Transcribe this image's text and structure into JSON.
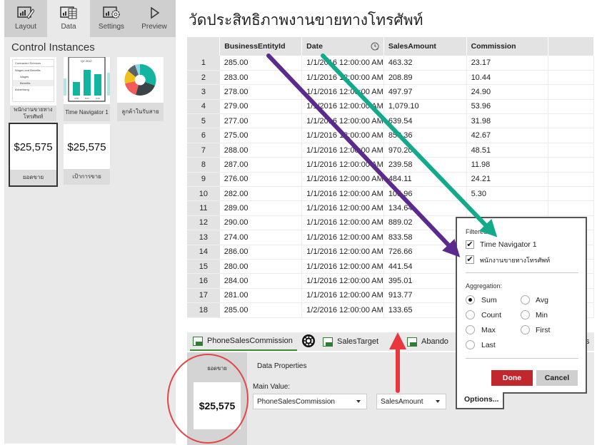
{
  "left_panel": {
    "tabs": [
      {
        "label": "Layout",
        "icon": "layout-chart-pencil-icon",
        "active": false
      },
      {
        "label": "Data",
        "icon": "data-chart-table-icon",
        "active": true
      },
      {
        "label": "Settings",
        "icon": "settings-chart-gear-icon",
        "active": false
      },
      {
        "label": "Preview",
        "icon": "play-triangle-icon",
        "active": false
      }
    ],
    "section_title": "Control Instances",
    "thumbnails": [
      {
        "caption": "พนักงานขายทางโทรศัพท์",
        "kind": "tree-list",
        "list_items": [
          "Contracted Services",
          "Wages and Benefits",
          "Wages",
          "Benefits",
          "Advertising"
        ]
      },
      {
        "caption": "Time Navigator 1",
        "kind": "time-navigator",
        "period": "Q2 2012",
        "months": [
          "APR",
          "MAY",
          "JUN"
        ]
      },
      {
        "caption": "ลูกค้าในรับสาย",
        "kind": "donut"
      },
      {
        "caption": "ยอดขาย",
        "kind": "kpi",
        "value": "$25,575",
        "selected": true
      },
      {
        "caption": "เป้าการขาย",
        "kind": "kpi",
        "value": "$25,575",
        "selected": false
      }
    ]
  },
  "main": {
    "title": "วัดประสิทธิภาพงานขายทางโทรศัพท์",
    "table": {
      "columns": [
        "BusinessEntityId",
        "Date",
        "SalesAmount",
        "Commission"
      ],
      "date_column_icon": "clock-filter-icon",
      "rows": [
        [
          "1",
          "285.00",
          "1/1/2016 12:00:00 AM",
          "463.32",
          "23.17"
        ],
        [
          "2",
          "283.00",
          "1/1/2016 12:00:00 AM",
          "208.89",
          "10.44"
        ],
        [
          "3",
          "278.00",
          "1/1/2016 12:00:00 AM",
          "497.97",
          "24.90"
        ],
        [
          "4",
          "279.00",
          "1/1/2016 12:00:00 AM",
          "1,079.10",
          "53.96"
        ],
        [
          "5",
          "277.00",
          "1/1/2016 12:00:00 AM",
          "639.54",
          "31.98"
        ],
        [
          "6",
          "275.00",
          "1/1/2016 12:00:00 AM",
          "853.36",
          "42.67"
        ],
        [
          "7",
          "288.00",
          "1/1/2016 12:00:00 AM",
          "970.20",
          "48.51"
        ],
        [
          "8",
          "287.00",
          "1/1/2016 12:00:00 AM",
          "239.58",
          "11.98"
        ],
        [
          "9",
          "276.00",
          "1/1/2016 12:00:00 AM",
          "484.11",
          "24.21"
        ],
        [
          "10",
          "282.00",
          "1/1/2016 12:00:00 AM",
          "105.96",
          "5.30"
        ],
        [
          "11",
          "289.00",
          "1/1/2016 12:00:00 AM",
          "134.64",
          ""
        ],
        [
          "12",
          "290.00",
          "1/1/2016 12:00:00 AM",
          "889.02",
          ""
        ],
        [
          "13",
          "274.00",
          "1/1/2016 12:00:00 AM",
          "833.58",
          ""
        ],
        [
          "14",
          "286.00",
          "1/1/2016 12:00:00 AM",
          "726.66",
          ""
        ],
        [
          "15",
          "280.00",
          "1/1/2016 12:00:00 AM",
          "441.54",
          ""
        ],
        [
          "16",
          "284.00",
          "1/1/2016 12:00:00 AM",
          "395.01",
          ""
        ],
        [
          "17",
          "281.00",
          "1/1/2016 12:00:00 AM",
          "913.77",
          ""
        ],
        [
          "18",
          "285.00",
          "1/2/2016 12:00:00 AM",
          "133.65",
          ""
        ]
      ]
    },
    "sheet_tabs": [
      {
        "label": "PhoneSalesCommission",
        "active": true
      },
      {
        "label": "SalesTarget",
        "active": false
      },
      {
        "label": "Abando",
        "active": false
      },
      {
        "label": "s",
        "active": false
      }
    ],
    "bottom": {
      "preview_caption": "ยอดขาย",
      "preview_value": "$25,575",
      "data_properties_label": "Data Properties",
      "main_value_label": "Main Value:",
      "main_value_source": "PhoneSalesCommission",
      "main_value_column": "SalesAmount",
      "options_label": "Options..."
    },
    "options_popup": {
      "filtered_label": "Filtered:",
      "filters": [
        {
          "label": "Time Navigator 1",
          "checked": true
        },
        {
          "label": "พนักงานขายทางโทรศัพท์",
          "checked": true
        }
      ],
      "aggregation_label": "Aggregation:",
      "aggregations": [
        {
          "label": "Sum",
          "selected": true
        },
        {
          "label": "Avg",
          "selected": false
        },
        {
          "label": "Count",
          "selected": false
        },
        {
          "label": "Min",
          "selected": false
        },
        {
          "label": "Max",
          "selected": false
        },
        {
          "label": "First",
          "selected": false
        },
        {
          "label": "Last",
          "selected": false
        }
      ],
      "done_label": "Done",
      "cancel_label": "Cancel",
      "check_glyph": "✔"
    }
  },
  "annotations": {
    "purple_arrow_color": "#5b2a8c",
    "teal_arrow_color": "#13a98b",
    "red_arrow_color": "#e8383d",
    "red_circle_color": "#e04848",
    "done_button_color": "#c1272d",
    "active_tab_underline": "#3c8d2f"
  }
}
